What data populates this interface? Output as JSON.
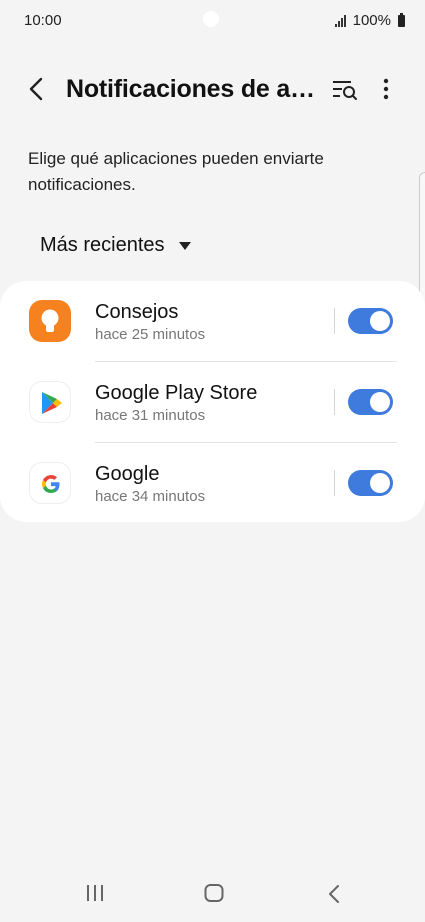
{
  "status_bar": {
    "time": "10:00",
    "battery": "100%"
  },
  "header": {
    "title": "Notificaciones de aplicaciones"
  },
  "description": "Elige qué aplicaciones pueden enviarte notificaciones.",
  "sort": {
    "label": "Más recientes"
  },
  "apps": [
    {
      "name": "Consejos",
      "time": "hace 25 minutos",
      "enabled": true
    },
    {
      "name": "Google Play Store",
      "time": "hace 31 minutos",
      "enabled": true
    },
    {
      "name": "Google",
      "time": "hace 34 minutos",
      "enabled": true
    }
  ],
  "colors": {
    "accent": "#3e7bdd",
    "consejos": "#f5821f",
    "background": "#f4f4f4"
  }
}
